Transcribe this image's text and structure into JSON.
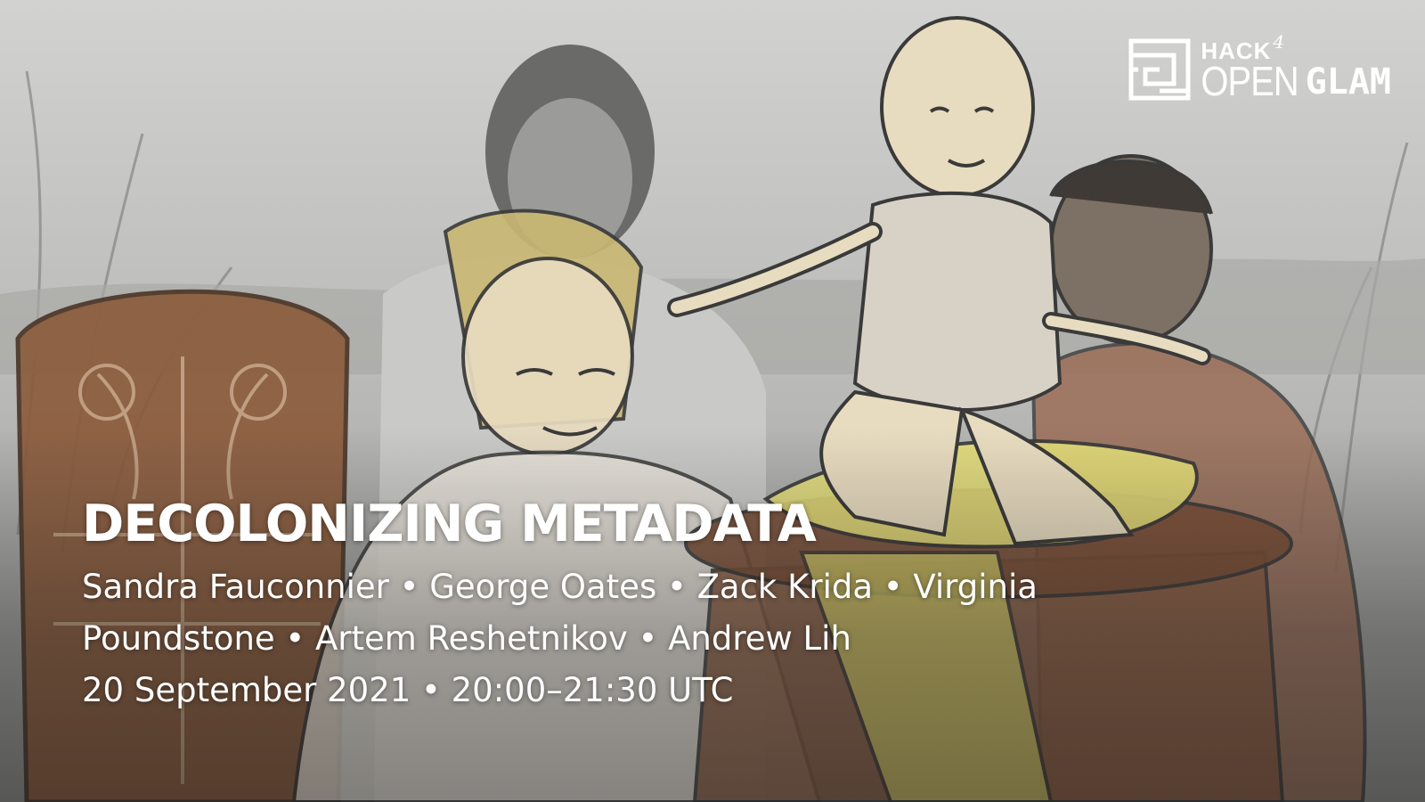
{
  "logo": {
    "hack": "HACK",
    "four": "4",
    "open": "OPEN",
    "glam": "GLAM"
  },
  "event": {
    "title": "DECOLONIZING METADATA",
    "speakers": "Sandra Fauconnier • George Oates • Zack Krida • Virginia Poundstone • Artem Reshetnikov • Andrew Lih",
    "datetime": "20 September 2021 • 20:00–21:30 UTC"
  },
  "colors": {
    "text": "#ffffff",
    "skin": "#e8dcc0",
    "yellow_cloth": "#e6df7a",
    "wood": "#8b5a3a",
    "line": "#3a3a3a"
  }
}
